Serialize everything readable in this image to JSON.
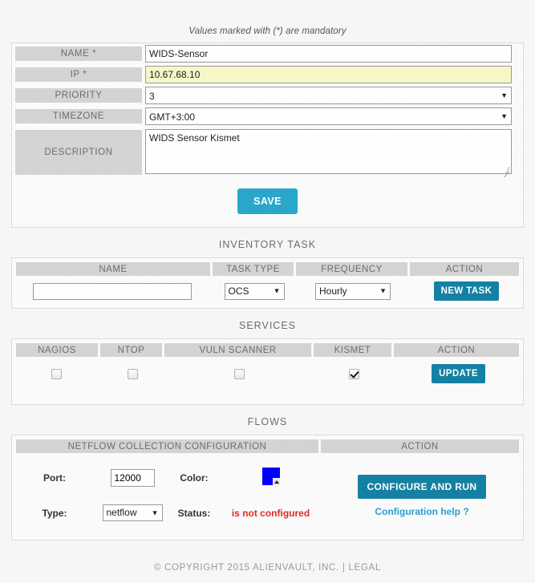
{
  "mandatory_note": "Values marked with (*) are mandatory",
  "sensor_form": {
    "rows": [
      {
        "label": "NAME *",
        "value": "WIDS-Sensor"
      },
      {
        "label": "IP *",
        "value": "10.67.68.10"
      },
      {
        "label": "PRIORITY",
        "value": "3"
      },
      {
        "label": "TIMEZONE",
        "value": "GMT+3:00"
      },
      {
        "label": "DESCRIPTION",
        "value": "WIDS Sensor Kismet"
      }
    ],
    "save_label": "SAVE"
  },
  "inventory": {
    "title": "INVENTORY TASK",
    "headers": [
      "NAME",
      "TASK TYPE",
      "FREQUENCY",
      "ACTION"
    ],
    "name_value": "",
    "name_placeholder": "",
    "task_type": "OCS",
    "frequency": "Hourly",
    "new_task_label": "NEW TASK"
  },
  "services": {
    "title": "SERVICES",
    "headers": [
      "NAGIOS",
      "NTOP",
      "VULN SCANNER",
      "KISMET",
      "ACTION"
    ],
    "checks": {
      "nagios": false,
      "ntop": false,
      "vuln_scanner": false,
      "kismet": true
    },
    "update_label": "UPDATE"
  },
  "flows": {
    "title": "FLOWS",
    "headers": [
      "NETFLOW COLLECTION CONFIGURATION",
      "ACTION"
    ],
    "port_label": "Port:",
    "port_value": "12000",
    "type_label": "Type:",
    "type_value": "netflow",
    "color_label": "Color:",
    "color_value": "#0000ff",
    "status_label": "Status:",
    "status_value": "is not configured",
    "configure_label": "CONFIGURE AND RUN",
    "help_label": "Configuration help ?"
  },
  "footer": {
    "copyright": "© COPYRIGHT 2015 ALIENVAULT, INC.  |  ",
    "legal": "LEGAL"
  },
  "theme": {
    "accent_light": "#29a8cc",
    "accent_dark": "#1581a3",
    "header_gray": "#d4d4d4",
    "status_red": "#e02b20",
    "link_blue": "#2a9fd0"
  }
}
